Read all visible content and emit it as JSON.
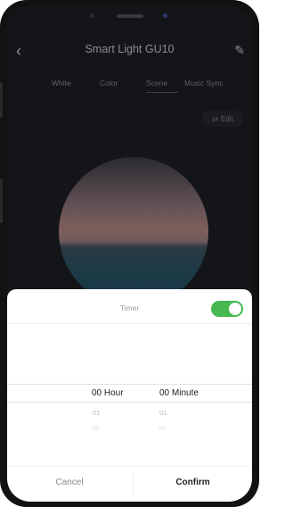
{
  "header": {
    "title": "Smart Light GU10"
  },
  "tabs": [
    {
      "label": "White"
    },
    {
      "label": "Color"
    },
    {
      "label": "Scene"
    },
    {
      "label": "Music Sync"
    }
  ],
  "edit": {
    "label": "Edit",
    "icon": "sliders-icon"
  },
  "timer_sheet": {
    "title": "Timer",
    "toggle_on": true,
    "hour": {
      "selected": "00 Hour",
      "next1": "01",
      "next2": "02"
    },
    "minute": {
      "selected": "00 Minute",
      "next1": "01",
      "next2": "02"
    },
    "cancel_label": "Cancel",
    "confirm_label": "Confirm"
  },
  "colors": {
    "accent_green": "#46b84f"
  }
}
